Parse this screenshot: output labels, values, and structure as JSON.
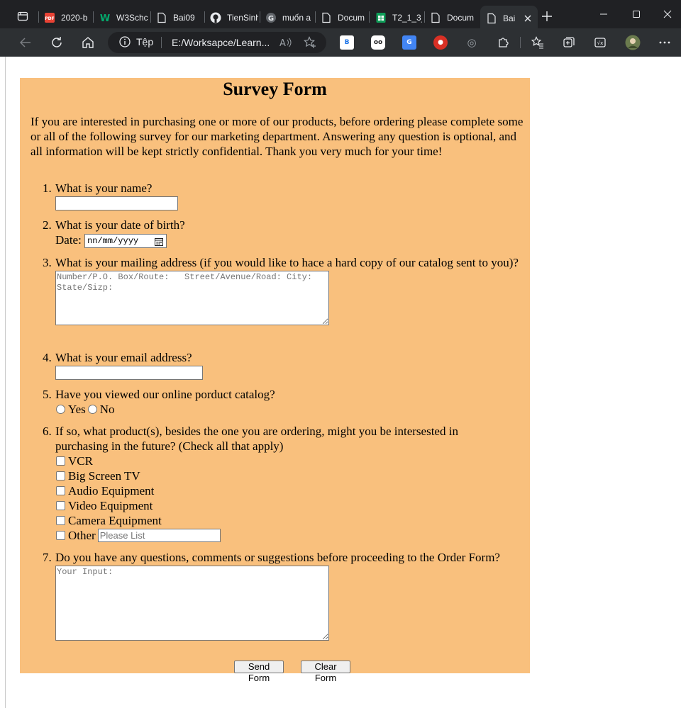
{
  "browser": {
    "tabs": [
      {
        "label": "2020-b",
        "icon": "pdf-icon"
      },
      {
        "label": "W3Schc",
        "icon": "w3schools-icon"
      },
      {
        "label": "Bai09",
        "icon": "page-icon"
      },
      {
        "label": "TienSinh",
        "icon": "github-icon"
      },
      {
        "label": "muốn a",
        "icon": "google-icon"
      },
      {
        "label": "Docum",
        "icon": "page-icon"
      },
      {
        "label": "T2_1_3_",
        "icon": "sheets-icon"
      },
      {
        "label": "Docum",
        "icon": "page-icon"
      },
      {
        "label": "Bai",
        "icon": "page-icon",
        "active": true
      }
    ],
    "address": {
      "site_label": "Tệp",
      "url": "E:/Worksapce/Learn..."
    },
    "extensions": [
      "B",
      "oo",
      "G",
      "●",
      "◎"
    ]
  },
  "form": {
    "title": "Survey Form",
    "intro": "If you are interested in purchasing one or more of our products, before ordering please complete some or all of the following survey for our marketing department. Answering any question is optional, and all information will be kept strictly confidential. Thank you very much for your time!",
    "q1": {
      "num": "1.",
      "text": "What is your name?"
    },
    "q2": {
      "num": "2.",
      "text": "What is your date of birth?",
      "date_label": "Date:",
      "date_value": "nn/mm/yyyy"
    },
    "q3": {
      "num": "3.",
      "text": "What is your mailing address (if you would like to hace a hard copy of our catalog sent to you)?",
      "placeholder": "Number/P.O. Box/Route:   Street/Avenue/Road: City: State/Sizp:"
    },
    "q4": {
      "num": "4.",
      "text": "What is your email address?"
    },
    "q5": {
      "num": "5.",
      "text": "Have you viewed our online porduct catalog?",
      "yes": "Yes",
      "no": "No"
    },
    "q6": {
      "num": "6.",
      "text": "If so, what product(s), besides the one you are ordering, might you be intersested in purchasing in the future? (Check all that apply)",
      "options": [
        "VCR",
        "Big Screen TV",
        "Audio Equipment",
        "Video Equipment",
        "Camera Equipment"
      ],
      "other_label": "Other",
      "other_placeholder": "Please List"
    },
    "q7": {
      "num": "7.",
      "text": "Do you have any questions, comments or suggestions before proceeding to the Order Form?",
      "placeholder": "Your Input:"
    },
    "send_label": "Send Form",
    "clear_label": "Clear Form"
  }
}
